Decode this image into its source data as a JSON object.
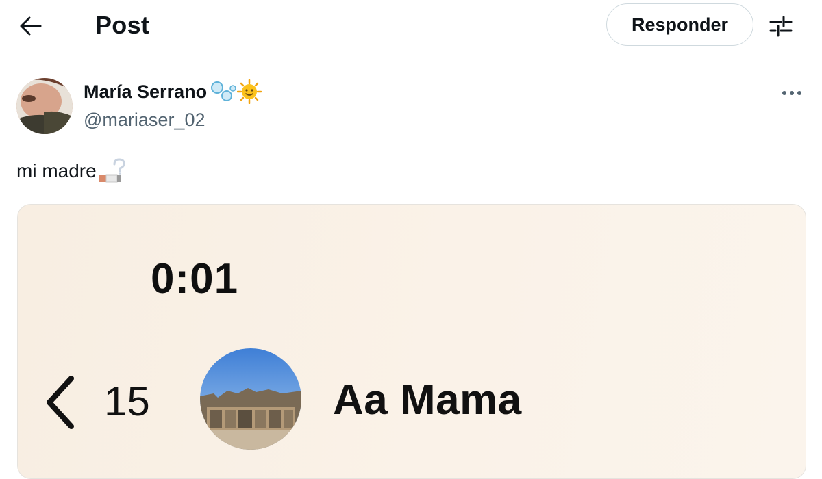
{
  "header": {
    "title": "Post",
    "back_icon": "arrow-left-icon",
    "reply_label": "Responder",
    "settings_icon": "sliders-icon"
  },
  "author": {
    "name": "María Serrano",
    "handle": "@mariaser_02",
    "name_emojis": [
      "bubbles-icon",
      "sun-face-icon"
    ],
    "more_icon": "ellipsis-icon"
  },
  "post": {
    "text": "mi madre",
    "text_emoji": "cigarette-question-icon"
  },
  "media": {
    "time": "0:01",
    "unread": "15",
    "contact_name": "Aa Mama",
    "back_icon": "chevron-left-icon"
  },
  "colors": {
    "text": "#0f1419",
    "secondary": "#536471",
    "border": "#cfd9de",
    "media_bg": "#f9f0e6"
  }
}
